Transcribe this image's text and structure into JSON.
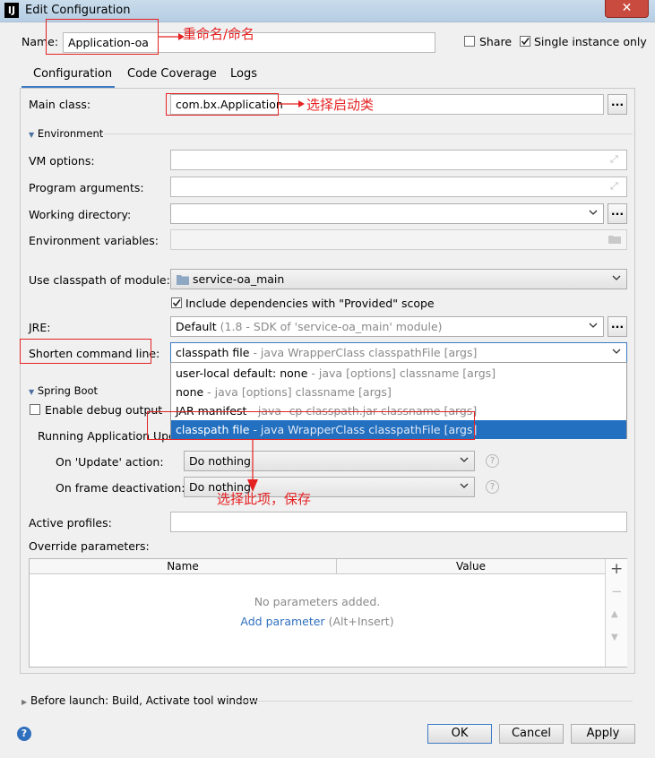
{
  "window": {
    "title": "Edit Configuration",
    "app_icon": "IJ"
  },
  "name_row": {
    "label": "Name:",
    "value": "Application-oa",
    "share": "Share",
    "share_checked": false,
    "single_instance": "Single instance only",
    "single_instance_checked": true
  },
  "tabs": [
    {
      "label": "Configuration",
      "active": true
    },
    {
      "label": "Code Coverage"
    },
    {
      "label": "Logs"
    }
  ],
  "main_class": {
    "label": "Main class:",
    "value": "com.bx.Application",
    "browse": "..."
  },
  "environment": {
    "title": "Environment",
    "vm_options": "VM options:",
    "program_arguments": "Program arguments:",
    "working_directory": "Working directory:",
    "environment_variables": "Environment variables:",
    "browse": "..."
  },
  "classpath": {
    "label": "Use classpath of module:",
    "value": "service-oa_main",
    "include_deps": "Include dependencies with \"Provided\" scope",
    "include_checked": true
  },
  "jre": {
    "label": "JRE:",
    "value_main": "Default",
    "value_detail": "(1.8 - SDK of 'service-oa_main' module)",
    "browse": "..."
  },
  "shorten": {
    "label": "Shorten command line:",
    "value_main": "classpath file",
    "value_detail": "- java WrapperClass classpathFile [args]",
    "options": [
      {
        "main": "user-local default: none",
        "detail": "- java [options] classname [args]"
      },
      {
        "main": "none",
        "detail": "- java [options] classname [args]"
      },
      {
        "main": "JAR manifest",
        "detail": "- java -cp classpath.jar classname [args]"
      },
      {
        "main": "classpath file",
        "detail": "- java WrapperClass classpathFile [args]",
        "selected": true
      }
    ]
  },
  "spring_boot": {
    "title": "Spring Boot",
    "debug_output": "Enable debug output",
    "running_update": "Running Application Update",
    "on_update_label": "On 'Update' action:",
    "on_update_value": "Do nothing",
    "on_frame_label": "On frame deactivation:",
    "on_frame_value": "Do nothing",
    "help": "?"
  },
  "active_profiles": "Active profiles:",
  "override": {
    "label": "Override parameters:",
    "col_name": "Name",
    "col_value": "Value",
    "empty": "No parameters added.",
    "add_link": "Add parameter",
    "add_hint": "(Alt+Insert)",
    "add": "+",
    "remove": "−",
    "up": "▲",
    "down": "▼"
  },
  "before_launch": "Before launch: Build, Activate tool window",
  "buttons": {
    "ok": "OK",
    "cancel": "Cancel",
    "apply": "Apply",
    "help": "?"
  },
  "annotations": {
    "rename": "重命名/命名",
    "select_class": "选择启动类",
    "select_option": "选择此项，保存"
  },
  "colors": {
    "annotation": "#e52222",
    "selection": "#2370c0",
    "link": "#2f6fbd"
  }
}
